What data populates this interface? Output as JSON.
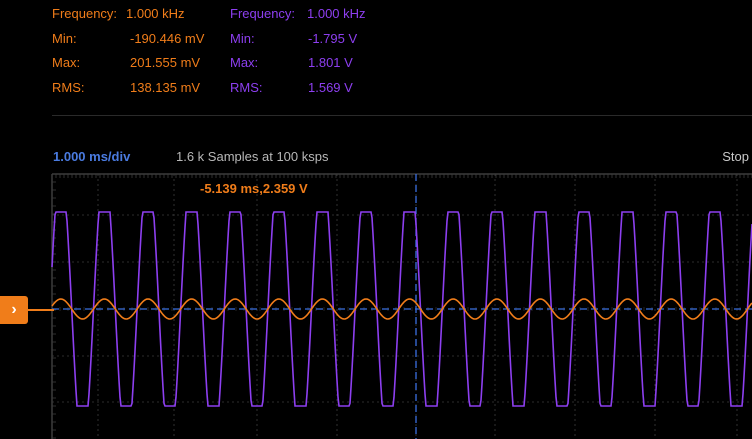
{
  "colors": {
    "ch1": "#f07d1a",
    "ch2": "#8d3ff0",
    "cursor": "#3b6fe0",
    "grid": "#3c3c3c"
  },
  "ch1_stats": {
    "freq_label": "Frequency:",
    "freq_value": "1.000 kHz",
    "min_label": "Min:",
    "min_value": "-190.446 mV",
    "max_label": "Max:",
    "max_value": "201.555 mV",
    "rms_label": "RMS:",
    "rms_value": "138.135 mV"
  },
  "ch2_stats": {
    "freq_label": "Frequency:",
    "freq_value": "1.000 kHz",
    "min_label": "Min:",
    "min_value": "-1.795 V",
    "max_label": "Max:",
    "max_value": "1.801 V",
    "rms_label": "RMS:",
    "rms_value": "1.569 V"
  },
  "toolbar": {
    "timebase": "1.000 ms/div",
    "samples": "1.6 k Samples at 100 ksps",
    "run_state": "Stop"
  },
  "cursor": {
    "readout": "-5.139 ms,2.359 V"
  },
  "channel_marker": {
    "glyph": "›",
    "icon": "chevron-right-icon"
  },
  "waveforms": {
    "cycles_visible": 16,
    "ch1": {
      "shape": "sine"
    },
    "ch2": {
      "shape": "clipped-sine"
    }
  }
}
